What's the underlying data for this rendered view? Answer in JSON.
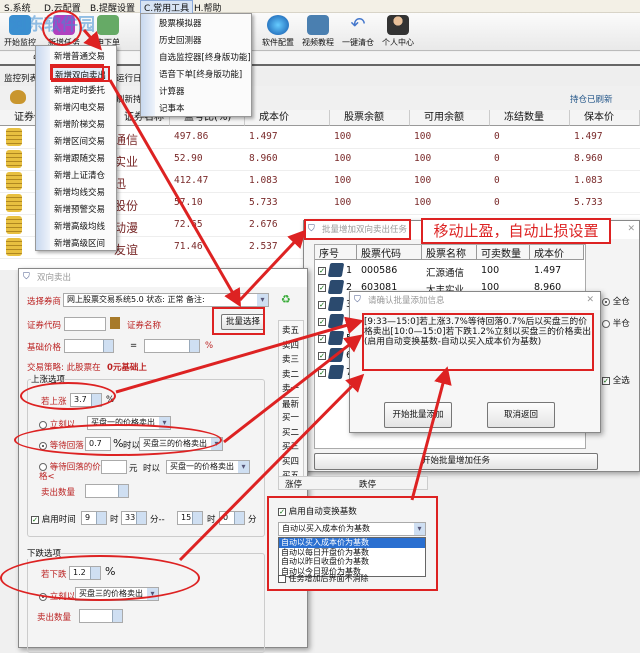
{
  "watermark": "河东软件园",
  "menubar": [
    "S.系统",
    "D.云配置",
    "B.提醒设置",
    "C.常用工具",
    "H.帮助"
  ],
  "toolbar": [
    "开始监控",
    "新增任务",
    "申下单",
    "软件配置",
    "视频教程",
    "一键清仓",
    "个人中心"
  ],
  "tabs": {
    "monitor": "监控列表",
    "log": "运行日志",
    "refresh": "刷新持"
  },
  "position_status": "持仓已刷新",
  "holdings": {
    "headers": [
      "证券代码",
      "证券名称",
      "盈亏比(%)",
      "成本价",
      "股票余额",
      "可用余额",
      "冻结数量",
      "保本价"
    ],
    "rows": [
      {
        "name": "通信",
        "ratio": "497.86",
        "cost": "1.497",
        "bal": "100",
        "avail": "100",
        "frozen": "0",
        "be": "1.497"
      },
      {
        "name": "实业",
        "ratio": "52.90",
        "cost": "8.960",
        "bal": "100",
        "avail": "100",
        "frozen": "0",
        "be": "8.960"
      },
      {
        "name": "迅",
        "ratio": "412.47",
        "cost": "1.083",
        "bal": "100",
        "avail": "100",
        "frozen": "0",
        "be": "1.083"
      },
      {
        "name": "股份",
        "ratio": "57.10",
        "cost": "5.733",
        "bal": "100",
        "avail": "100",
        "frozen": "0",
        "be": "5.733"
      },
      {
        "name": "动漫",
        "ratio": "72.65",
        "cost": "2.676",
        "bal": "",
        "avail": "",
        "frozen": "",
        "be": ""
      },
      {
        "name": "友谊",
        "ratio": "71.46",
        "cost": "2.537",
        "bal": "",
        "avail": "",
        "frozen": "",
        "be": ""
      }
    ]
  },
  "task_menu": [
    "新增普通交易",
    "新增双向卖出",
    "新增定时委托",
    "新增闪电交易",
    "新增阶梯交易",
    "新增区间交易",
    "新增跟随交易",
    "新增上证清仓",
    "新增均线交易",
    "新增预警交易",
    "新增高级均线",
    "新增高级区间"
  ],
  "tools_menu": [
    "股票模拟器",
    "历史回测器",
    "自选监控器[终身版功能]",
    "语音下单[终身版功能]",
    "计算器",
    "记事本"
  ],
  "sell_dialog": {
    "title": "双向卖出",
    "broker_label": "选择券商",
    "broker_value": "网上股票交易系统5.0 状态: 正常 备注:",
    "batch_select": "批量选择",
    "code_label": "证券代码",
    "name_label": "证券名称",
    "base_label": "基础价格",
    "equals": "=",
    "percent": "%",
    "strategy_label": "交易策略: 此股票在",
    "strategy_value": "0元基础上",
    "rise_group": "上涨选项",
    "rise_label": "若上涨",
    "rise_value": "3.7",
    "immediate_label": "立刻以",
    "immediate_price": "买盘一的价格卖出",
    "wait_label": "等待回落",
    "wait_value": "0.7",
    "when_label": "时以",
    "wait_price": "买盘三的价格卖出",
    "wait_price_label": "等待回落的价格<",
    "yuan": "元",
    "wait_price2": "买盘一的价格卖出",
    "qty_label": "卖出数量",
    "enable_time": "启用时间",
    "h1": "9",
    "m1": "33",
    "h2": "15",
    "m2": "0",
    "hour": "时",
    "minute": "分",
    "dash": "分--",
    "fall_group": "下跌选项",
    "fall_label": "若下跌",
    "fall_value": "1.2",
    "fall_immediate": "立刻以",
    "fall_price": "买盘三的价格卖出",
    "orderbook": [
      "卖五",
      "卖四",
      "卖三",
      "卖二",
      "卖一",
      "最新",
      "买一",
      "买二",
      "买三",
      "买四",
      "买五"
    ],
    "limit_up": "涨停",
    "limit_down": "跌停"
  },
  "batch_dialog": {
    "title": "批量增加双向卖出任务",
    "headers": [
      "序号",
      "股票代码",
      "股票名称",
      "可卖数量",
      "成本价"
    ],
    "rows": [
      {
        "no": "1",
        "code": "000586",
        "name": "汇源通信",
        "qty": "100",
        "cost": "1.497"
      },
      {
        "no": "2",
        "code": "603081",
        "name": "大丰实业",
        "qty": "100",
        "cost": "8.960"
      },
      {
        "no": "3"
      },
      {
        "no": "4"
      },
      {
        "no": "5"
      },
      {
        "no": "6"
      },
      {
        "no": "7"
      }
    ],
    "full": "全仓",
    "half": "半仓",
    "select_all": "全选",
    "start": "开始批量增加任务"
  },
  "confirm_dialog": {
    "title": "请确认批量添加信息",
    "message": "[9:33—15:0]若上涨3.7%等待回落0.7%后以买盘三的价格卖出[10:0—15:0]若下跌1.2%立刻以买盘三的价格卖出\n(启用自动变换基数-自动以买入成本价为基数)",
    "ok": "开始批量添加",
    "cancel": "取消返回"
  },
  "auto_base": {
    "enable": "启用自动变换基数",
    "selected": "自动以买入成本价为基数",
    "options": [
      "自动以买入成本价为基数",
      "自动以每日开盘价为基数",
      "自动以昨日收盘价为基数",
      "自动以今日现价为基数"
    ],
    "keep": "任务增加后界面不消除"
  },
  "annotation": "移动止盈，自动止损设置",
  "colors": {
    "annotation": "#d22222",
    "accent": "#3366cc"
  }
}
